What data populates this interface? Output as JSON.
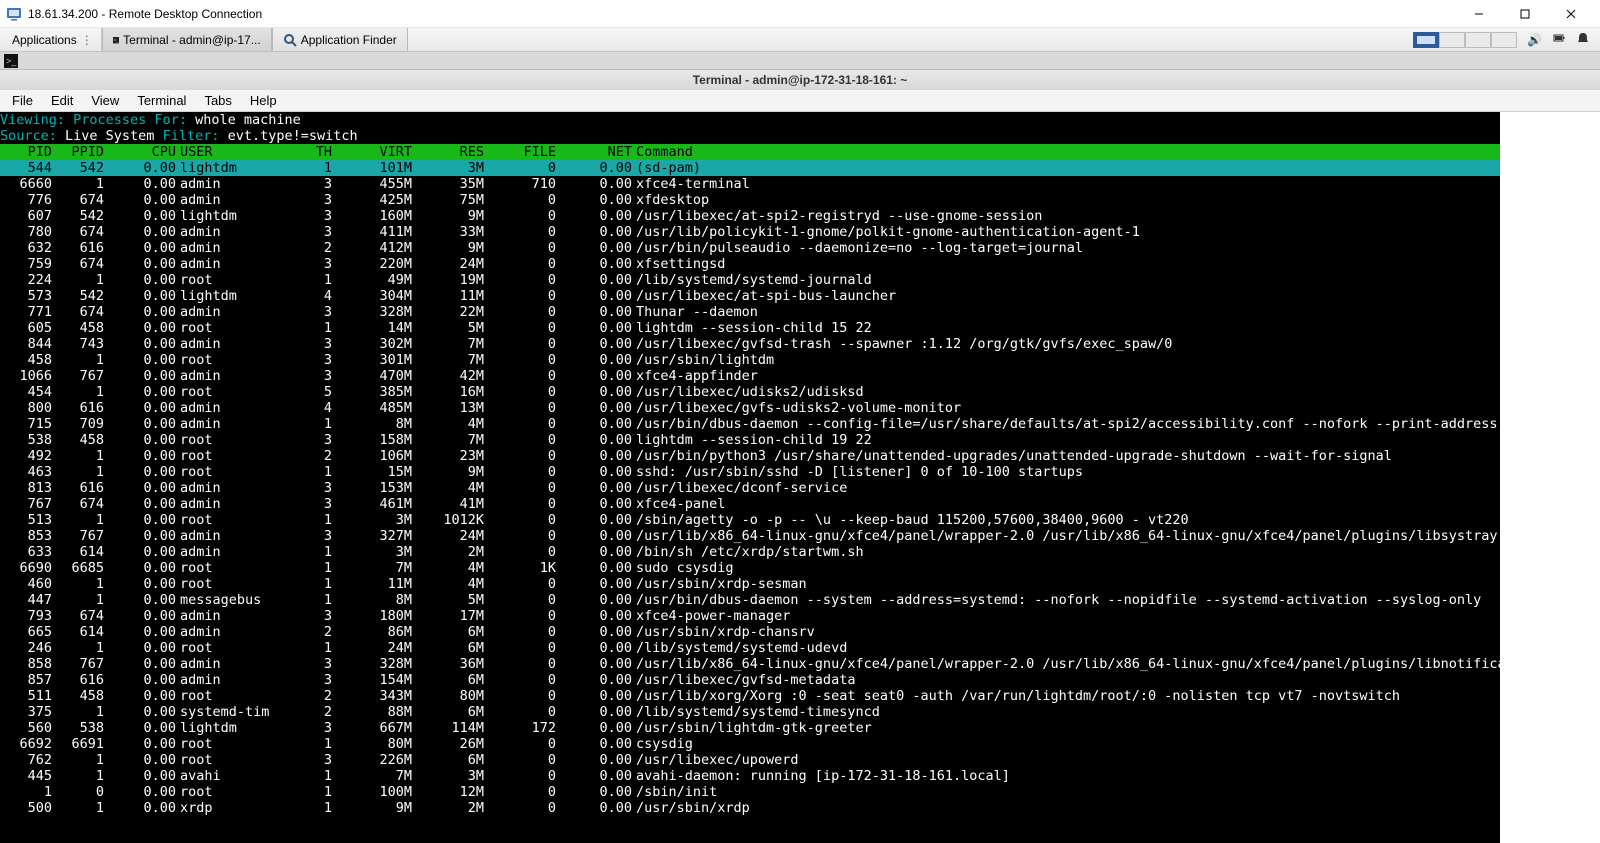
{
  "win_title": "18.61.34.200 - Remote Desktop Connection",
  "xfce": {
    "applications": "Applications",
    "task1": "Terminal - admin@ip-17...",
    "task2": "Application Finder"
  },
  "term_window_title": "Terminal - admin@ip-172-31-18-161: ~",
  "term_menu": [
    "File",
    "Edit",
    "View",
    "Terminal",
    "Tabs",
    "Help"
  ],
  "viewing_label": "Viewing:",
  "viewing_value": "Processes For:",
  "viewing_target": "whole machine",
  "source_label": "Source:",
  "source_value": "Live System",
  "filter_label": "Filter:",
  "filter_value": "evt.type!=switch",
  "columns": [
    "PID",
    "PPID",
    "CPU",
    "USER",
    "TH",
    "VIRT",
    "RES",
    "FILE",
    "NET",
    "Command"
  ],
  "rows": [
    {
      "sel": true,
      "pid": "544",
      "ppid": "542",
      "cpu": "0.00",
      "user": "lightdm",
      "th": "1",
      "virt": "101M",
      "res": "3M",
      "file": "0",
      "net": "0.00",
      "cmd": "(sd-pam)"
    },
    {
      "pid": "6660",
      "ppid": "1",
      "cpu": "0.00",
      "user": "admin",
      "th": "3",
      "virt": "455M",
      "res": "35M",
      "file": "710",
      "net": "0.00",
      "cmd": "xfce4-terminal"
    },
    {
      "pid": "776",
      "ppid": "674",
      "cpu": "0.00",
      "user": "admin",
      "th": "3",
      "virt": "425M",
      "res": "75M",
      "file": "0",
      "net": "0.00",
      "cmd": "xfdesktop"
    },
    {
      "pid": "607",
      "ppid": "542",
      "cpu": "0.00",
      "user": "lightdm",
      "th": "3",
      "virt": "160M",
      "res": "9M",
      "file": "0",
      "net": "0.00",
      "cmd": "/usr/libexec/at-spi2-registryd --use-gnome-session"
    },
    {
      "pid": "780",
      "ppid": "674",
      "cpu": "0.00",
      "user": "admin",
      "th": "3",
      "virt": "411M",
      "res": "33M",
      "file": "0",
      "net": "0.00",
      "cmd": "/usr/lib/policykit-1-gnome/polkit-gnome-authentication-agent-1"
    },
    {
      "pid": "632",
      "ppid": "616",
      "cpu": "0.00",
      "user": "admin",
      "th": "2",
      "virt": "412M",
      "res": "9M",
      "file": "0",
      "net": "0.00",
      "cmd": "/usr/bin/pulseaudio --daemonize=no --log-target=journal"
    },
    {
      "pid": "759",
      "ppid": "674",
      "cpu": "0.00",
      "user": "admin",
      "th": "3",
      "virt": "220M",
      "res": "24M",
      "file": "0",
      "net": "0.00",
      "cmd": "xfsettingsd"
    },
    {
      "pid": "224",
      "ppid": "1",
      "cpu": "0.00",
      "user": "root",
      "th": "1",
      "virt": "49M",
      "res": "19M",
      "file": "0",
      "net": "0.00",
      "cmd": "/lib/systemd/systemd-journald"
    },
    {
      "pid": "573",
      "ppid": "542",
      "cpu": "0.00",
      "user": "lightdm",
      "th": "4",
      "virt": "304M",
      "res": "11M",
      "file": "0",
      "net": "0.00",
      "cmd": "/usr/libexec/at-spi-bus-launcher"
    },
    {
      "pid": "771",
      "ppid": "674",
      "cpu": "0.00",
      "user": "admin",
      "th": "3",
      "virt": "328M",
      "res": "22M",
      "file": "0",
      "net": "0.00",
      "cmd": "Thunar --daemon"
    },
    {
      "pid": "605",
      "ppid": "458",
      "cpu": "0.00",
      "user": "root",
      "th": "1",
      "virt": "14M",
      "res": "5M",
      "file": "0",
      "net": "0.00",
      "cmd": "lightdm --session-child 15 22"
    },
    {
      "pid": "844",
      "ppid": "743",
      "cpu": "0.00",
      "user": "admin",
      "th": "3",
      "virt": "302M",
      "res": "7M",
      "file": "0",
      "net": "0.00",
      "cmd": "/usr/libexec/gvfsd-trash --spawner :1.12 /org/gtk/gvfs/exec_spaw/0"
    },
    {
      "pid": "458",
      "ppid": "1",
      "cpu": "0.00",
      "user": "root",
      "th": "3",
      "virt": "301M",
      "res": "7M",
      "file": "0",
      "net": "0.00",
      "cmd": "/usr/sbin/lightdm"
    },
    {
      "pid": "1066",
      "ppid": "767",
      "cpu": "0.00",
      "user": "admin",
      "th": "3",
      "virt": "470M",
      "res": "42M",
      "file": "0",
      "net": "0.00",
      "cmd": "xfce4-appfinder"
    },
    {
      "pid": "454",
      "ppid": "1",
      "cpu": "0.00",
      "user": "root",
      "th": "5",
      "virt": "385M",
      "res": "16M",
      "file": "0",
      "net": "0.00",
      "cmd": "/usr/libexec/udisks2/udisksd"
    },
    {
      "pid": "800",
      "ppid": "616",
      "cpu": "0.00",
      "user": "admin",
      "th": "4",
      "virt": "485M",
      "res": "13M",
      "file": "0",
      "net": "0.00",
      "cmd": "/usr/libexec/gvfs-udisks2-volume-monitor"
    },
    {
      "pid": "715",
      "ppid": "709",
      "cpu": "0.00",
      "user": "admin",
      "th": "1",
      "virt": "8M",
      "res": "4M",
      "file": "0",
      "net": "0.00",
      "cmd": "/usr/bin/dbus-daemon --config-file=/usr/share/defaults/at-spi2/accessibility.conf --nofork --print-address"
    },
    {
      "pid": "538",
      "ppid": "458",
      "cpu": "0.00",
      "user": "root",
      "th": "3",
      "virt": "158M",
      "res": "7M",
      "file": "0",
      "net": "0.00",
      "cmd": "lightdm --session-child 19 22"
    },
    {
      "pid": "492",
      "ppid": "1",
      "cpu": "0.00",
      "user": "root",
      "th": "2",
      "virt": "106M",
      "res": "23M",
      "file": "0",
      "net": "0.00",
      "cmd": "/usr/bin/python3 /usr/share/unattended-upgrades/unattended-upgrade-shutdown --wait-for-signal"
    },
    {
      "pid": "463",
      "ppid": "1",
      "cpu": "0.00",
      "user": "root",
      "th": "1",
      "virt": "15M",
      "res": "9M",
      "file": "0",
      "net": "0.00",
      "cmd": "sshd: /usr/sbin/sshd -D [listener] 0 of 10-100 startups"
    },
    {
      "pid": "813",
      "ppid": "616",
      "cpu": "0.00",
      "user": "admin",
      "th": "3",
      "virt": "153M",
      "res": "4M",
      "file": "0",
      "net": "0.00",
      "cmd": "/usr/libexec/dconf-service"
    },
    {
      "pid": "767",
      "ppid": "674",
      "cpu": "0.00",
      "user": "admin",
      "th": "3",
      "virt": "461M",
      "res": "41M",
      "file": "0",
      "net": "0.00",
      "cmd": "xfce4-panel"
    },
    {
      "pid": "513",
      "ppid": "1",
      "cpu": "0.00",
      "user": "root",
      "th": "1",
      "virt": "3M",
      "res": "1012K",
      "file": "0",
      "net": "0.00",
      "cmd": "/sbin/agetty -o -p -- \\u --keep-baud 115200,57600,38400,9600 - vt220"
    },
    {
      "pid": "853",
      "ppid": "767",
      "cpu": "0.00",
      "user": "admin",
      "th": "3",
      "virt": "327M",
      "res": "24M",
      "file": "0",
      "net": "0.00",
      "cmd": "/usr/lib/x86_64-linux-gnu/xfce4/panel/wrapper-2.0 /usr/lib/x86_64-linux-gnu/xfce4/panel/plugins/libsystray"
    },
    {
      "pid": "633",
      "ppid": "614",
      "cpu": "0.00",
      "user": "admin",
      "th": "1",
      "virt": "3M",
      "res": "2M",
      "file": "0",
      "net": "0.00",
      "cmd": "/bin/sh /etc/xrdp/startwm.sh"
    },
    {
      "pid": "6690",
      "ppid": "6685",
      "cpu": "0.00",
      "user": "root",
      "th": "1",
      "virt": "7M",
      "res": "4M",
      "file": "1K",
      "net": "0.00",
      "cmd": "sudo csysdig"
    },
    {
      "pid": "460",
      "ppid": "1",
      "cpu": "0.00",
      "user": "root",
      "th": "1",
      "virt": "11M",
      "res": "4M",
      "file": "0",
      "net": "0.00",
      "cmd": "/usr/sbin/xrdp-sesman"
    },
    {
      "pid": "447",
      "ppid": "1",
      "cpu": "0.00",
      "user": "messagebus",
      "th": "1",
      "virt": "8M",
      "res": "5M",
      "file": "0",
      "net": "0.00",
      "cmd": "/usr/bin/dbus-daemon --system --address=systemd: --nofork --nopidfile --systemd-activation --syslog-only"
    },
    {
      "pid": "793",
      "ppid": "674",
      "cpu": "0.00",
      "user": "admin",
      "th": "3",
      "virt": "180M",
      "res": "17M",
      "file": "0",
      "net": "0.00",
      "cmd": "xfce4-power-manager"
    },
    {
      "pid": "665",
      "ppid": "614",
      "cpu": "0.00",
      "user": "admin",
      "th": "2",
      "virt": "86M",
      "res": "6M",
      "file": "0",
      "net": "0.00",
      "cmd": "/usr/sbin/xrdp-chansrv"
    },
    {
      "pid": "246",
      "ppid": "1",
      "cpu": "0.00",
      "user": "root",
      "th": "1",
      "virt": "24M",
      "res": "6M",
      "file": "0",
      "net": "0.00",
      "cmd": "/lib/systemd/systemd-udevd"
    },
    {
      "pid": "858",
      "ppid": "767",
      "cpu": "0.00",
      "user": "admin",
      "th": "3",
      "virt": "328M",
      "res": "36M",
      "file": "0",
      "net": "0.00",
      "cmd": "/usr/lib/x86_64-linux-gnu/xfce4/panel/wrapper-2.0 /usr/lib/x86_64-linux-gnu/xfce4/panel/plugins/libnotifica"
    },
    {
      "pid": "857",
      "ppid": "616",
      "cpu": "0.00",
      "user": "admin",
      "th": "3",
      "virt": "154M",
      "res": "6M",
      "file": "0",
      "net": "0.00",
      "cmd": "/usr/libexec/gvfsd-metadata"
    },
    {
      "pid": "511",
      "ppid": "458",
      "cpu": "0.00",
      "user": "root",
      "th": "2",
      "virt": "343M",
      "res": "80M",
      "file": "0",
      "net": "0.00",
      "cmd": "/usr/lib/xorg/Xorg :0 -seat seat0 -auth /var/run/lightdm/root/:0 -nolisten tcp vt7 -novtswitch"
    },
    {
      "pid": "375",
      "ppid": "1",
      "cpu": "0.00",
      "user": "systemd-tim",
      "th": "2",
      "virt": "88M",
      "res": "6M",
      "file": "0",
      "net": "0.00",
      "cmd": "/lib/systemd/systemd-timesyncd"
    },
    {
      "pid": "560",
      "ppid": "538",
      "cpu": "0.00",
      "user": "lightdm",
      "th": "3",
      "virt": "667M",
      "res": "114M",
      "file": "172",
      "net": "0.00",
      "cmd": "/usr/sbin/lightdm-gtk-greeter"
    },
    {
      "pid": "6692",
      "ppid": "6691",
      "cpu": "0.00",
      "user": "root",
      "th": "1",
      "virt": "80M",
      "res": "26M",
      "file": "0",
      "net": "0.00",
      "cmd": "csysdig"
    },
    {
      "pid": "762",
      "ppid": "1",
      "cpu": "0.00",
      "user": "root",
      "th": "3",
      "virt": "226M",
      "res": "6M",
      "file": "0",
      "net": "0.00",
      "cmd": "/usr/libexec/upowerd"
    },
    {
      "pid": "445",
      "ppid": "1",
      "cpu": "0.00",
      "user": "avahi",
      "th": "1",
      "virt": "7M",
      "res": "3M",
      "file": "0",
      "net": "0.00",
      "cmd": "avahi-daemon: running [ip-172-31-18-161.local]"
    },
    {
      "pid": "1",
      "ppid": "0",
      "cpu": "0.00",
      "user": "root",
      "th": "1",
      "virt": "100M",
      "res": "12M",
      "file": "0",
      "net": "0.00",
      "cmd": "/sbin/init"
    },
    {
      "pid": "500",
      "ppid": "1",
      "cpu": "0.00",
      "user": "xrdp",
      "th": "1",
      "virt": "9M",
      "res": "2M",
      "file": "0",
      "net": "0.00",
      "cmd": "/usr/sbin/xrdp"
    }
  ]
}
